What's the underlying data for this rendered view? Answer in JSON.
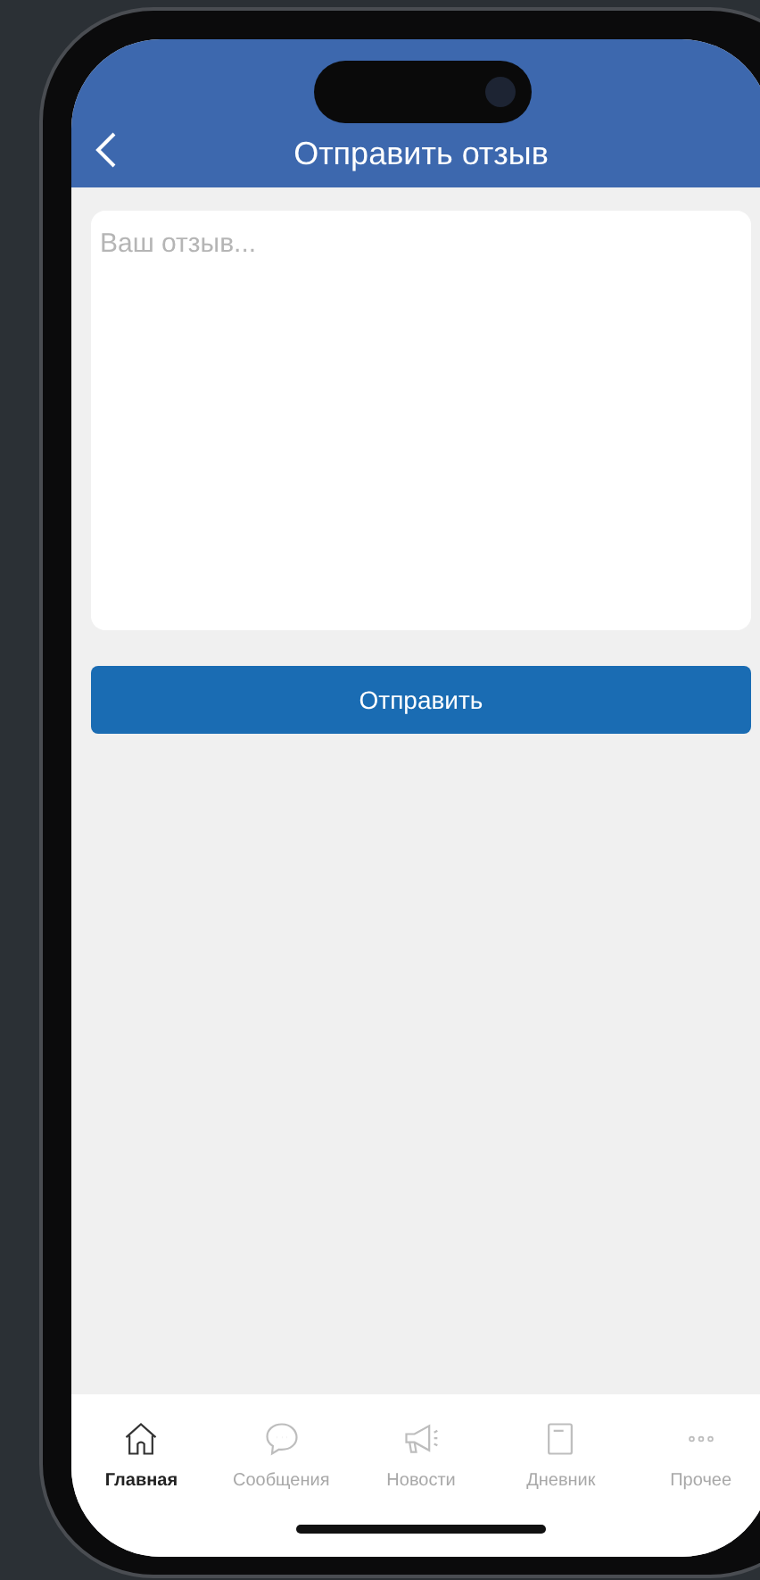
{
  "header": {
    "title": "Отправить отзыв"
  },
  "feedback": {
    "placeholder": "Ваш отзыв..."
  },
  "submit_button": "Отправить",
  "tab_bar": [
    {
      "kind": "home",
      "label": "Главная",
      "selected": true
    },
    {
      "kind": "chat",
      "label": "Сообщения",
      "selected": false
    },
    {
      "kind": "megaphone",
      "label": "Новости",
      "selected": false
    },
    {
      "kind": "book",
      "label": "Дневник",
      "selected": false
    },
    {
      "kind": "more",
      "label": "Прочее",
      "selected": false
    }
  ]
}
